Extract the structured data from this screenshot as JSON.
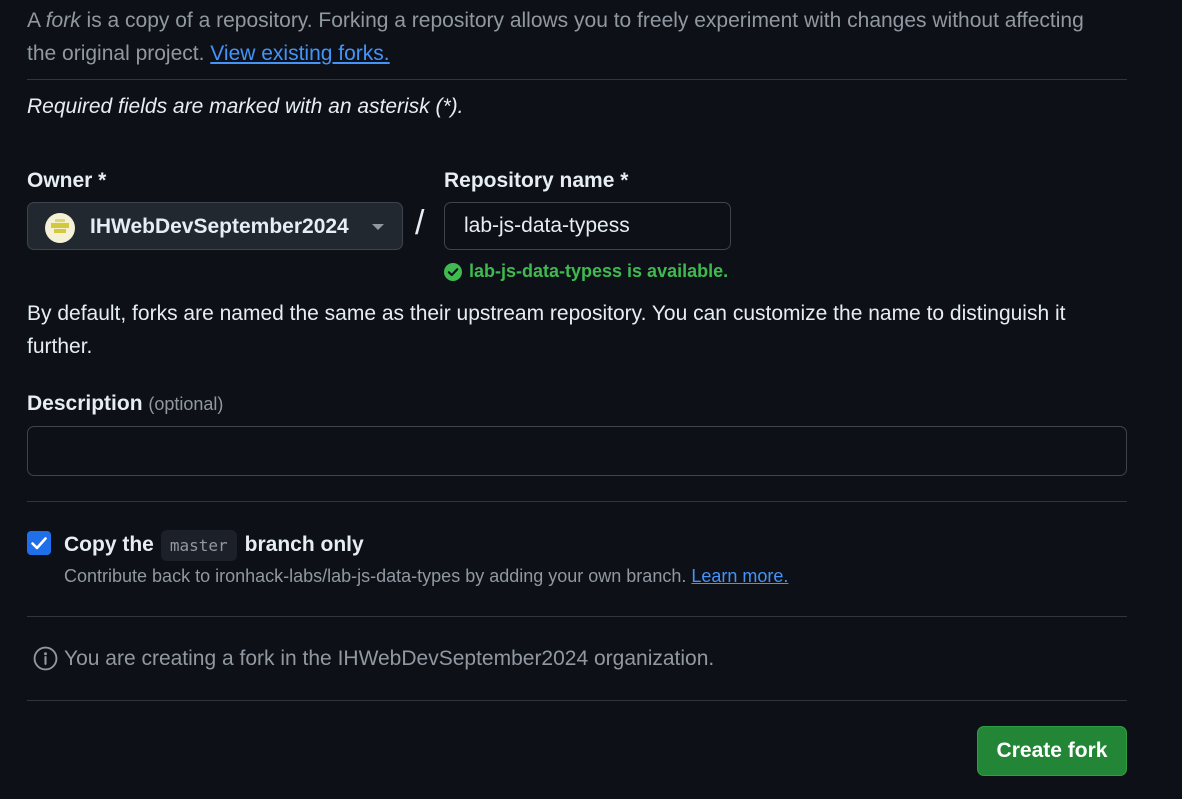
{
  "intro": {
    "prefix": "A ",
    "fork_word": "fork",
    "text": " is a copy of a repository. Forking a repository allows you to freely experiment with changes without affecting the original project. ",
    "link": "View existing forks."
  },
  "required_note": "Required fields are marked with an asterisk (*).",
  "owner": {
    "label": "Owner *",
    "value": "IHWebDevSeptember2024"
  },
  "separator": "/",
  "repo_name": {
    "label": "Repository name *",
    "value": "lab-js-data-typess",
    "availability": "lab-js-data-typess is available."
  },
  "naming_hint": "By default, forks are named the same as their upstream repository. You can customize the name to distinguish it further.",
  "description": {
    "label": "Description",
    "optional": "(optional)",
    "value": ""
  },
  "copy_branch": {
    "checked": true,
    "prefix": "Copy the",
    "branch": "master",
    "suffix": "branch only",
    "contribute_text": "Contribute back to ironhack-labs/lab-js-data-types by adding your own branch.",
    "learn_more": "Learn more."
  },
  "info_message": "You are creating a fork in the IHWebDevSeptember2024 organization.",
  "create_button": "Create fork",
  "colors": {
    "background": "#0d1117",
    "link": "#4493f8",
    "success": "#3fb950",
    "primary_button": "#238636",
    "checkbox": "#1f6feb"
  },
  "icons": [
    "owner-avatar-icon",
    "caret-down-icon",
    "check-circle-icon",
    "checkmark-icon",
    "info-icon"
  ]
}
